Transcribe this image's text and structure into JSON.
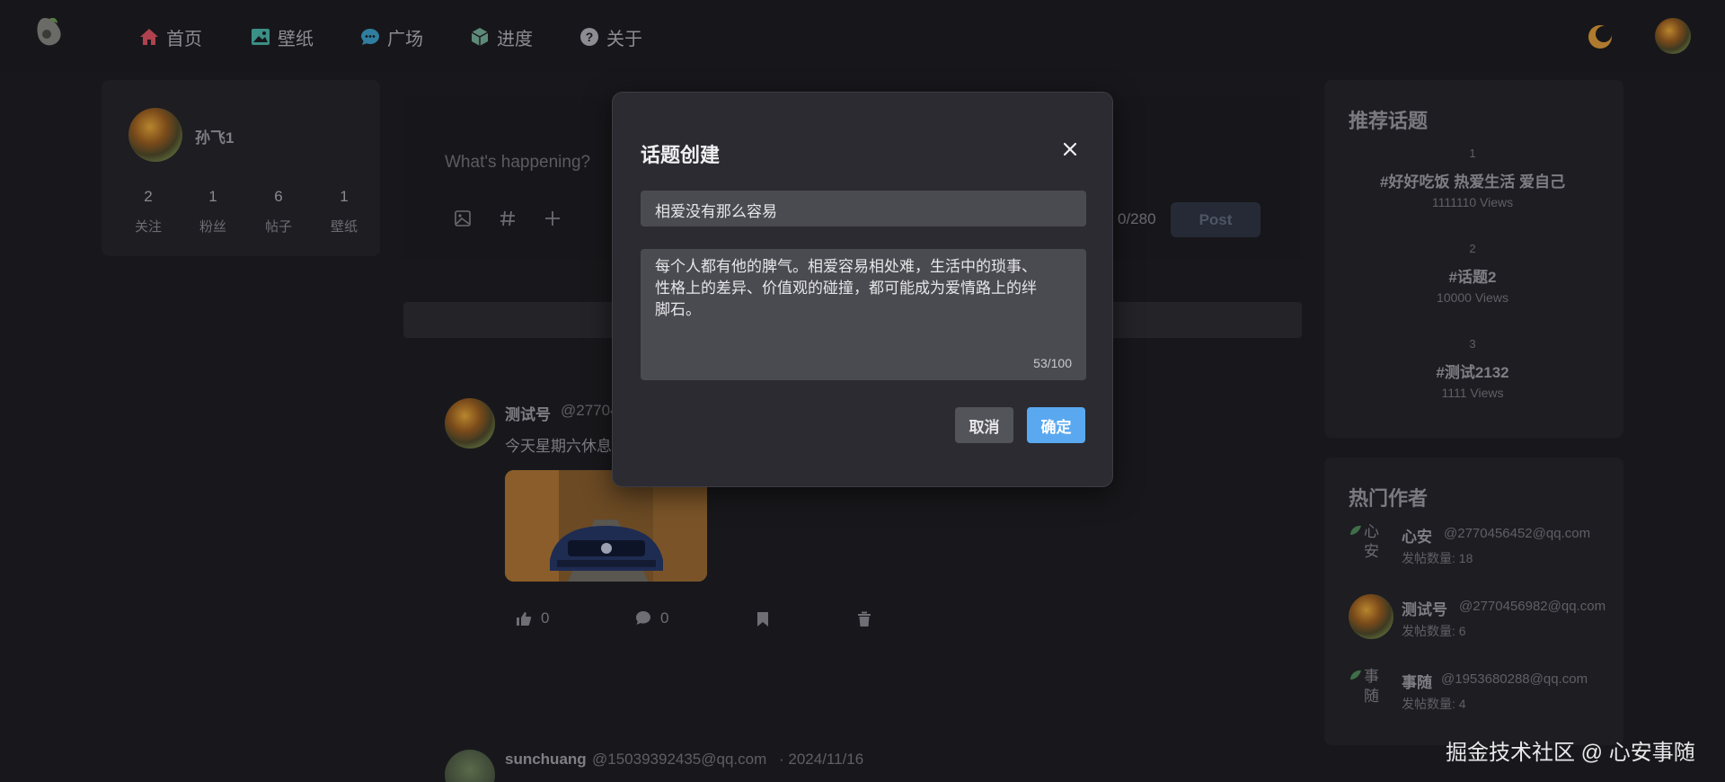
{
  "nav": {
    "items": [
      {
        "label": "首页",
        "icon": "home-icon",
        "color": "#b0414e"
      },
      {
        "label": "壁纸",
        "icon": "image-icon",
        "color": "#3a8f86"
      },
      {
        "label": "广场",
        "icon": "chat-icon",
        "color": "#2f7ea0"
      },
      {
        "label": "进度",
        "icon": "cube-icon",
        "color": "#5e8a7a"
      },
      {
        "label": "关于",
        "icon": "question-icon",
        "color": "#8c8c92"
      }
    ],
    "moon_color": "#b07a2e"
  },
  "profile": {
    "name": "孙飞1",
    "stats": [
      {
        "value": "2",
        "label": "关注"
      },
      {
        "value": "1",
        "label": "粉丝"
      },
      {
        "value": "6",
        "label": "帖子"
      },
      {
        "value": "1",
        "label": "壁纸"
      }
    ]
  },
  "compose": {
    "placeholder": "What's happening?",
    "count": "0/280",
    "post_label": "Post"
  },
  "feed": [
    {
      "name": "测试号",
      "handle": "@27704",
      "text": "今天星期六休息"
    },
    {
      "name": "sunchuang",
      "handle": "@15039392435@qq.com",
      "date": "· 2024/11/16"
    }
  ],
  "post_actions": {
    "likes": "0",
    "comments": "0"
  },
  "topics": {
    "title": "推荐话题",
    "items": [
      {
        "rank": "1",
        "name": "#好好吃饭 热爱生活 爱自己",
        "views": "1111110 Views"
      },
      {
        "rank": "2",
        "name": "#话题2",
        "views": "10000 Views"
      },
      {
        "rank": "3",
        "name": "#测试2132",
        "views": "1111 Views"
      }
    ]
  },
  "authors": {
    "title": "热门作者",
    "items": [
      {
        "alt": "心安",
        "name": "心安",
        "email": "@2770456452@qq.com",
        "count": "发帖数量: 18"
      },
      {
        "alt": "",
        "name": "测试号",
        "email": "@2770456982@qq.com",
        "count": "发帖数量: 6"
      },
      {
        "alt": "事随",
        "name": "事随",
        "email": "@1953680288@qq.com",
        "count": "发帖数量: 4"
      }
    ]
  },
  "modal": {
    "title": "话题创建",
    "input_value": "相爱没有那么容易",
    "textarea_value": "每个人都有他的脾气。相爱容易相处难，生活中的琐事、性格上的差异、价值观的碰撞，都可能成为爱情路上的绊脚石。",
    "char_count": "53/100",
    "cancel_label": "取消",
    "confirm_label": "确定",
    "confirm_color": "#5aa8f0"
  },
  "watermark": "掘金技术社区 @ 心安事随"
}
